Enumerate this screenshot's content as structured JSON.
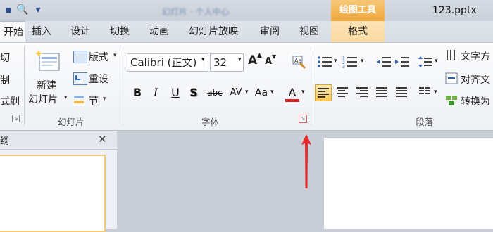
{
  "title_bar": {
    "drawing_tools_label": "绘图工具",
    "file_name": "123.pptx",
    "blurred_title": "幻灯片 · 个人中心"
  },
  "tabs": [
    {
      "label": "开始",
      "active": true
    },
    {
      "label": "插入"
    },
    {
      "label": "设计"
    },
    {
      "label": "切换"
    },
    {
      "label": "动画"
    },
    {
      "label": "幻灯片放映"
    },
    {
      "label": "审阅"
    },
    {
      "label": "视图"
    },
    {
      "label": "格式"
    }
  ],
  "clipboard": {
    "cut_label": "切",
    "copy_label": "制",
    "format_painter_label": "式刷"
  },
  "slides_group": {
    "new_slide_label_1": "新建",
    "new_slide_label_2": "幻灯片",
    "layout_label": "版式",
    "reset_label": "重设",
    "section_label": "节",
    "group_label": "幻灯片"
  },
  "font_group": {
    "font_name": "Calibri (正文)",
    "font_size": "32",
    "group_label": "字体",
    "bold": "B",
    "italic": "I",
    "underline": "U",
    "shadow": "S",
    "strike": "abc",
    "spacing": "AV",
    "case": "Aa",
    "color_letter": "A",
    "grow": "A",
    "shrink": "A"
  },
  "paragraph_group": {
    "group_label": "段落",
    "text_direction_label": "文字方",
    "align_text_label": "对齐文",
    "convert_label": "转换为"
  },
  "outline_panel": {
    "tab_label": "纲",
    "close_glyph": "✕"
  },
  "annotation": {
    "arrow_color": "#e8282b"
  }
}
